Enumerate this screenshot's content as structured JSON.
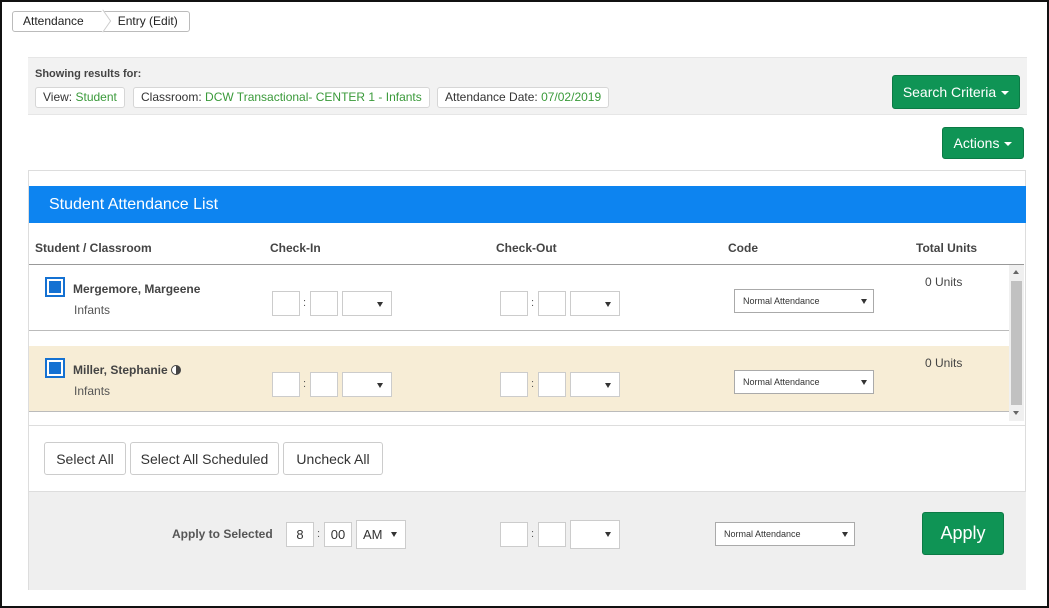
{
  "breadcrumb": {
    "items": [
      "Attendance",
      "Entry (Edit)"
    ]
  },
  "results": {
    "label": "Showing results for:",
    "view": {
      "key": "View:",
      "value": "Student"
    },
    "classroom": {
      "key": "Classroom:",
      "value": "DCW Transactional- CENTER 1 - Infants"
    },
    "date": {
      "key": "Attendance Date:",
      "value": "07/02/2019"
    },
    "search_button": "Search Criteria"
  },
  "actions_button": "Actions",
  "list": {
    "title": "Student Attendance List",
    "columns": [
      "Student / Classroom",
      "Check-In",
      "Check-Out",
      "Code",
      "Total Units"
    ],
    "rows": [
      {
        "name": "Mergemore, Margeene",
        "classroom": "Infants",
        "code": "Normal Attendance",
        "units": "0 Units",
        "checked": true
      },
      {
        "name": "Miller, Stephanie",
        "classroom": "Infants",
        "code": "Normal Attendance",
        "units": "0 Units",
        "checked": true
      }
    ]
  },
  "buttons": {
    "select_all": "Select All",
    "select_all_scheduled": "Select All Scheduled",
    "uncheck_all": "Uncheck All"
  },
  "apply": {
    "label": "Apply to Selected",
    "hour": "8",
    "minute": "00",
    "ampm": "AM",
    "code": "Normal Attendance",
    "button": "Apply"
  },
  "colors": {
    "brand_green": "#0f9455",
    "header_blue": "#0d84f0",
    "row_highlight": "#f7edd6",
    "value_green": "#3a9a3a"
  }
}
